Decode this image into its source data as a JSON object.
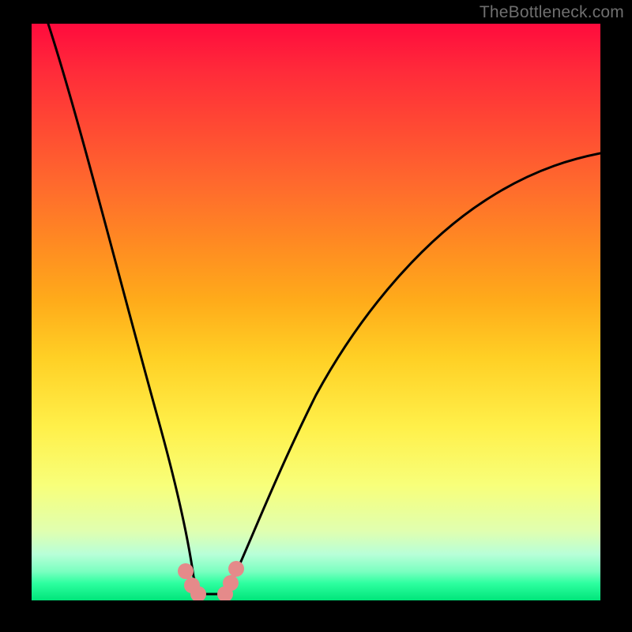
{
  "watermark": "TheBottleneck.com",
  "colors": {
    "background": "#000000",
    "curve": "#000000",
    "marker": "#e58a8a",
    "gradient_top": "#ff0b3d",
    "gradient_bottom": "#00e57a"
  },
  "chart_data": {
    "type": "line",
    "title": "",
    "xlabel": "",
    "ylabel": "",
    "xlim": [
      0,
      100
    ],
    "ylim": [
      0,
      100
    ],
    "series": [
      {
        "name": "left-branch",
        "x": [
          3,
          6,
          10,
          13,
          16,
          19,
          22,
          25,
          26.5,
          27.5,
          28.5
        ],
        "values": [
          100,
          87,
          72,
          60,
          48,
          37,
          25,
          12,
          5,
          1.5,
          0
        ]
      },
      {
        "name": "right-branch",
        "x": [
          33,
          35,
          38,
          42,
          47,
          53,
          60,
          68,
          77,
          87,
          100
        ],
        "values": [
          0,
          3,
          9,
          18,
          29,
          40,
          50,
          58,
          65,
          71,
          77
        ]
      }
    ],
    "markers": [
      {
        "x": 26.6,
        "y": 4.5
      },
      {
        "x": 27.5,
        "y": 1.5
      },
      {
        "x": 28.2,
        "y": 0.4
      },
      {
        "x": 32.9,
        "y": 0.4
      },
      {
        "x": 33.8,
        "y": 2.0
      },
      {
        "x": 34.8,
        "y": 5.2
      }
    ],
    "flat_bottom": {
      "x_start": 28.5,
      "x_end": 33,
      "y": 0
    }
  }
}
